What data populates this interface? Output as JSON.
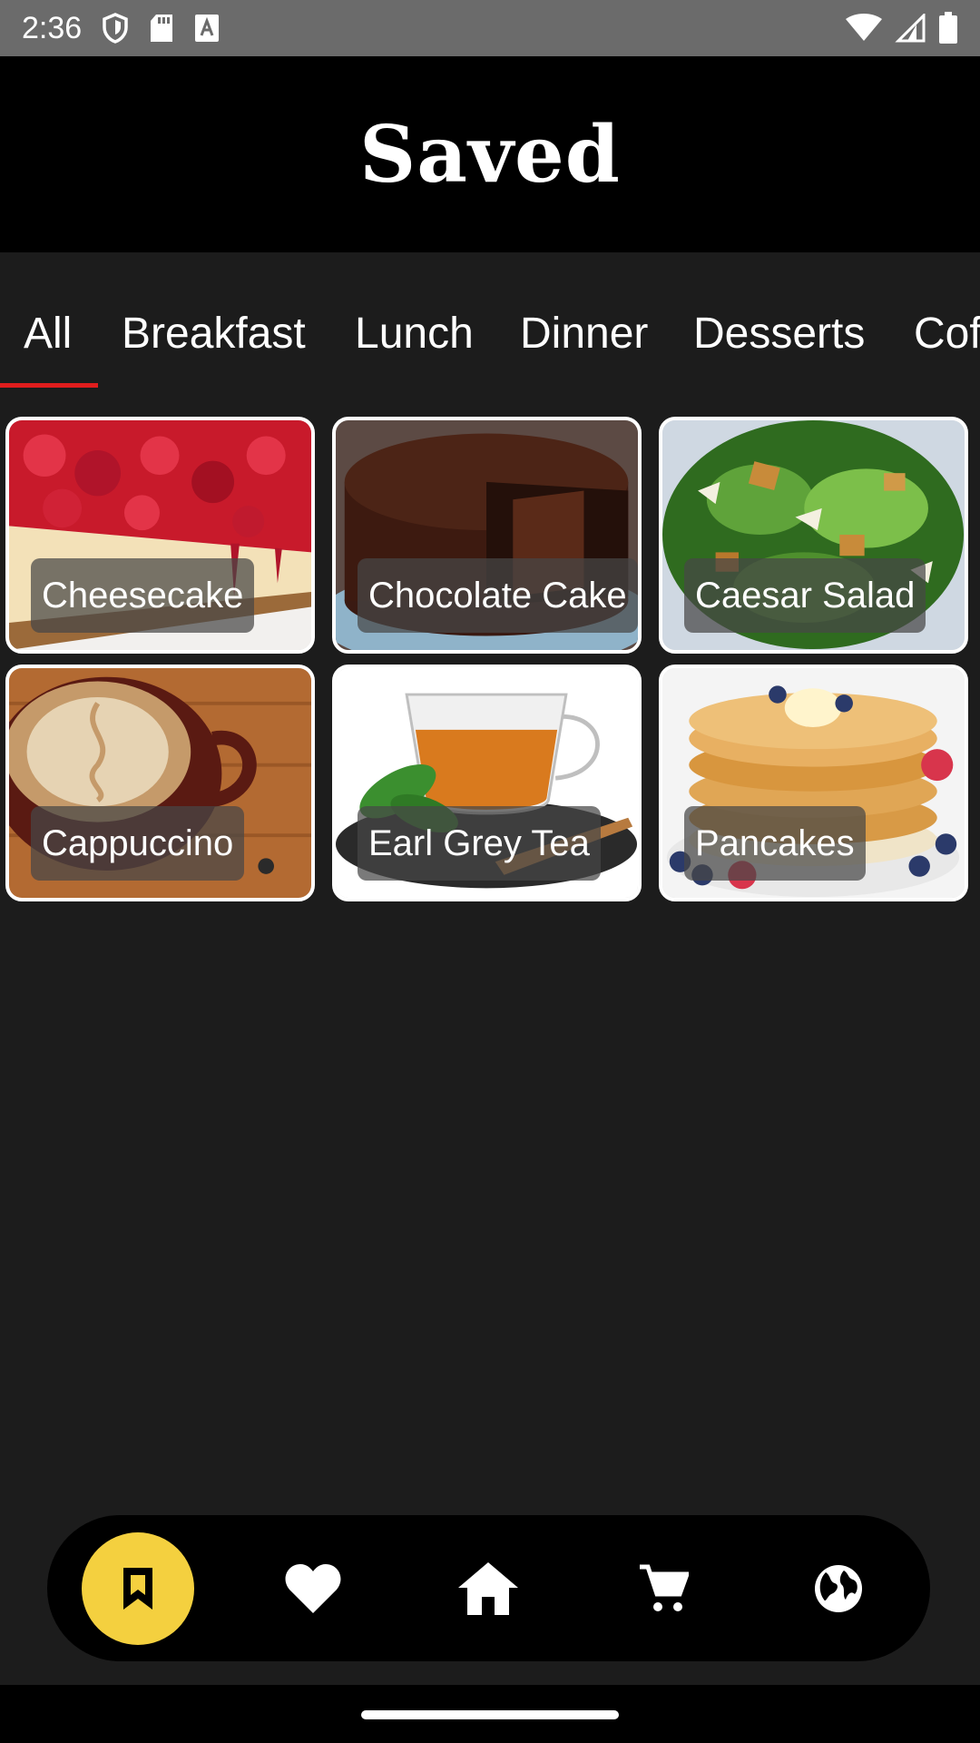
{
  "status_bar": {
    "time": "2:36",
    "icons_left": [
      "shield-icon",
      "sd-card-icon",
      "text-a-icon"
    ],
    "icons_right": [
      "wifi-icon",
      "signal-icon",
      "battery-icon"
    ]
  },
  "header": {
    "title": "Saved"
  },
  "tabs": [
    {
      "label": "All",
      "active": true
    },
    {
      "label": "Breakfast",
      "active": false
    },
    {
      "label": "Lunch",
      "active": false
    },
    {
      "label": "Dinner",
      "active": false
    },
    {
      "label": "Desserts",
      "active": false
    },
    {
      "label": "Cof",
      "active": false
    }
  ],
  "accent_colors": {
    "tab_indicator": "#e01d1d",
    "active_nav": "#f4d03f"
  },
  "recipes": [
    {
      "name": "Cheesecake",
      "image": "cheesecake-photo"
    },
    {
      "name": "Chocolate Cake",
      "image": "chocolate-cake-photo"
    },
    {
      "name": "Caesar Salad",
      "image": "caesar-salad-photo"
    },
    {
      "name": "Cappuccino",
      "image": "cappuccino-photo"
    },
    {
      "name": "Earl Grey Tea",
      "image": "earl-grey-tea-photo"
    },
    {
      "name": "Pancakes",
      "image": "pancakes-photo"
    }
  ],
  "bottom_nav": [
    {
      "icon": "bookmark-icon",
      "active": true
    },
    {
      "icon": "heart-icon",
      "active": false
    },
    {
      "icon": "home-icon",
      "active": false
    },
    {
      "icon": "cart-icon",
      "active": false
    },
    {
      "icon": "globe-icon",
      "active": false
    }
  ]
}
